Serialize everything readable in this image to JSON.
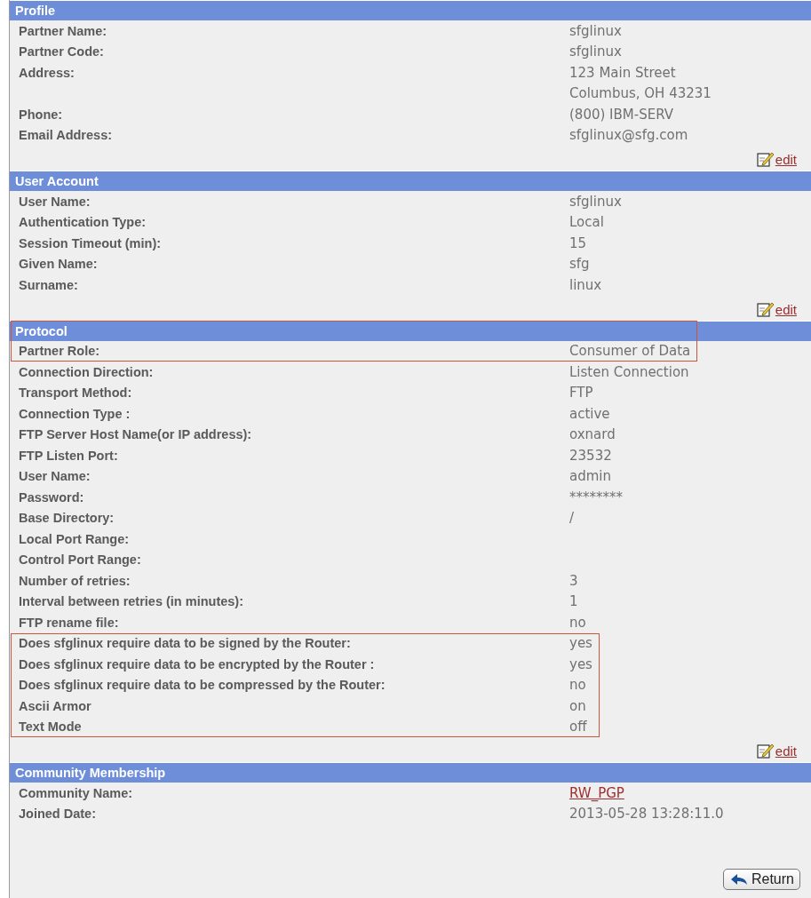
{
  "sections": [
    {
      "title": "Profile",
      "title_highlighted": false,
      "edit_link": "edit",
      "rows": [
        {
          "label": "Partner Name:",
          "value": "sfglinux",
          "highlighted": false
        },
        {
          "label": "Partner Code:",
          "value": "sfglinux",
          "highlighted": false
        },
        {
          "label": "Address:",
          "value": "123 Main Street",
          "highlighted": false
        },
        {
          "value": "Columbus, OH  43231",
          "highlighted": false
        },
        {
          "label": "Phone:",
          "value": "(800) IBM-SERV",
          "highlighted": false
        },
        {
          "label": "Email Address:",
          "value": "sfglinux@sfg.com",
          "highlighted": false
        }
      ]
    },
    {
      "title": "User Account",
      "title_highlighted": false,
      "edit_link": "edit",
      "rows": [
        {
          "label": "User Name:",
          "value": "sfglinux",
          "highlighted": false
        },
        {
          "label": "Authentication Type:",
          "value": "Local",
          "highlighted": false
        },
        {
          "label": "Session Timeout (min):",
          "value": "15",
          "highlighted": false
        },
        {
          "label": "Given Name:",
          "value": "sfg",
          "highlighted": false
        },
        {
          "label": "Surname:",
          "value": "linux",
          "highlighted": false
        }
      ]
    },
    {
      "title": "Protocol",
      "title_highlighted": true,
      "edit_link": "edit",
      "rows": [
        {
          "label": "Partner Role:",
          "value": "Consumer of Data",
          "highlighted": true
        },
        {
          "label": "Connection Direction:",
          "value": "Listen Connection",
          "highlighted": false
        },
        {
          "label": "Transport Method:",
          "value": "FTP",
          "highlighted": false
        },
        {
          "label": "Connection Type :",
          "value": "active",
          "highlighted": false
        },
        {
          "label": "FTP Server Host Name(or IP address):",
          "value": "oxnard",
          "highlighted": false
        },
        {
          "label": "FTP Listen Port:",
          "value": "23532",
          "highlighted": false
        },
        {
          "label": "User Name:",
          "value": "admin",
          "highlighted": false
        },
        {
          "label": "Password:",
          "value": "********",
          "highlighted": false
        },
        {
          "label": "Base Directory:",
          "value": "/",
          "highlighted": false
        },
        {
          "label": "Local Port Range:",
          "highlighted": false
        },
        {
          "label": "Control Port Range:",
          "highlighted": false
        },
        {
          "label": "Number of retries:",
          "value": "3",
          "highlighted": false
        },
        {
          "label": "Interval between retries (in minutes):",
          "value": "1",
          "highlighted": false
        },
        {
          "label": "FTP rename file:",
          "value": "no",
          "highlighted": false
        },
        {
          "label": "Does sfglinux require data to be signed by the Router:",
          "value": "yes",
          "highlighted": true
        },
        {
          "label": "Does sfglinux require data to be encrypted by the Router :",
          "value": "yes",
          "highlighted": true
        },
        {
          "label": "Does sfglinux require data to be compressed by the Router:",
          "value": "no",
          "highlighted": true
        },
        {
          "label": "Ascii Armor",
          "value": "on",
          "highlighted": true
        },
        {
          "label": "Text Mode",
          "value": "off",
          "highlighted": true
        }
      ]
    },
    {
      "title": "Community Membership",
      "title_highlighted": false,
      "rows": [
        {
          "label": "Community Name:",
          "value": "RW_PGP",
          "kind": "link",
          "highlighted": false
        },
        {
          "label": "Joined Date:",
          "value": "2013-05-28 13:28:11.0",
          "highlighted": false
        }
      ]
    }
  ],
  "return_button": "Return"
}
